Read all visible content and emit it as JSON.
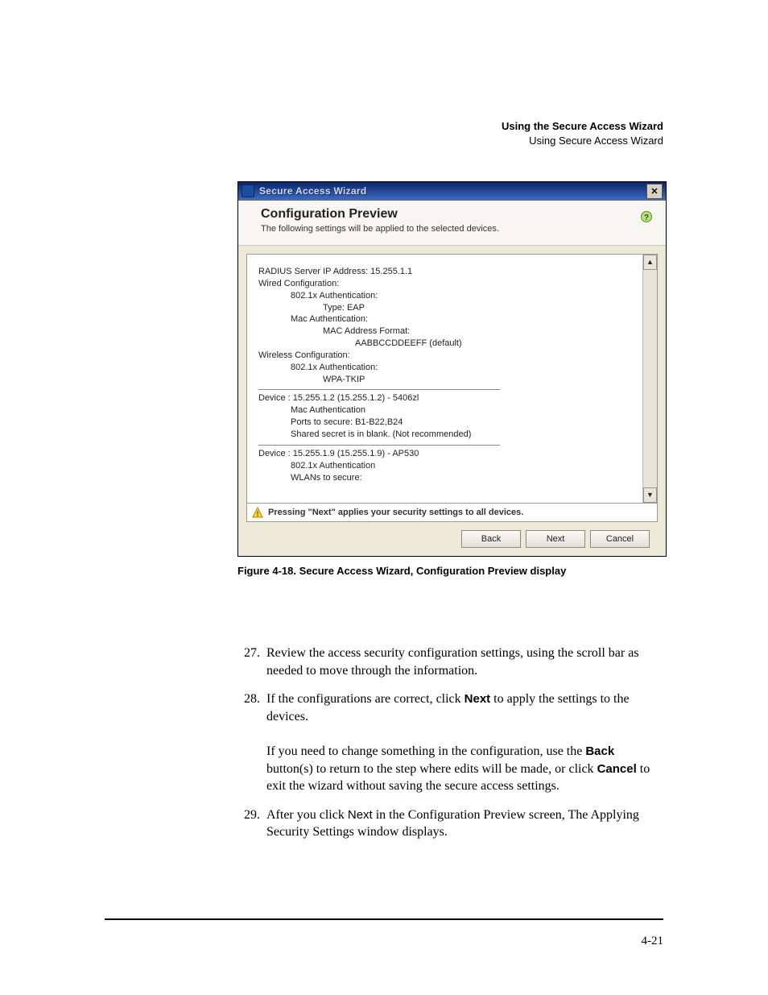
{
  "header": {
    "title_bold": "Using the Secure Access Wizard",
    "subtitle": "Using Secure Access Wizard"
  },
  "window": {
    "title": "Secure Access Wizard",
    "close_glyph": "✕",
    "heading": "Configuration Preview",
    "subheading": "The following settings will be applied to the selected devices.",
    "preview_lines": [
      {
        "cls": "",
        "text": "RADIUS Server IP Address: 15.255.1.1"
      },
      {
        "cls": "",
        "text": "Wired Configuration:"
      },
      {
        "cls": "ind1",
        "text": "802.1x Authentication:"
      },
      {
        "cls": "ind2",
        "text": "Type: EAP"
      },
      {
        "cls": "ind1",
        "text": "Mac Authentication:"
      },
      {
        "cls": "ind2",
        "text": "MAC Address Format:"
      },
      {
        "cls": "ind3",
        "text": "AABBCCDDEEFF (default)"
      },
      {
        "cls": "",
        "text": "Wireless Configuration:"
      },
      {
        "cls": "ind1",
        "text": "802.1x Authentication:"
      },
      {
        "cls": "ind2",
        "text": "WPA-TKIP"
      }
    ],
    "device1_header": "Device : 15.255.1.2 (15.255.1.2) - 5406zl",
    "device1_lines": [
      {
        "cls": "ind1",
        "text": "Mac Authentication"
      },
      {
        "cls": "ind1",
        "text": "Ports to secure: B1-B22,B24"
      },
      {
        "cls": "ind1",
        "text": "Shared secret is in blank. (Not recommended)"
      }
    ],
    "device2_header": "Device : 15.255.1.9 (15.255.1.9) - AP530",
    "device2_lines": [
      {
        "cls": "ind1",
        "text": "802.1x Authentication"
      },
      {
        "cls": "ind1",
        "text": "WLANs to secure:"
      }
    ],
    "warning_text": "Pressing \"Next\" applies your security settings to all devices.",
    "buttons": {
      "back": "Back",
      "next": "Next",
      "cancel": "Cancel"
    }
  },
  "figure_caption": "Figure 4-18. Secure Access Wizard, Configuration Preview display",
  "instructions": [
    {
      "n": "27.",
      "html": "Review the access security configuration settings, using the scroll bar as needed to move through the information."
    },
    {
      "n": "28.",
      "html": "If the configurations are correct, click <span class='b'>Next</span> to apply the settings to the devices.<br><br>If you need to change something in the configuration, use the <span class='b'>Back</span> button(s) to return to the step where edits will be made, or click <span class='b'>Cancel</span> to exit the wizard without saving the secure access settings."
    },
    {
      "n": "29.",
      "html": "After you click <span class='sf'>Next</span> in the Configuration Preview screen, The Applying Security Settings window displays."
    }
  ],
  "page_number": "4-21"
}
